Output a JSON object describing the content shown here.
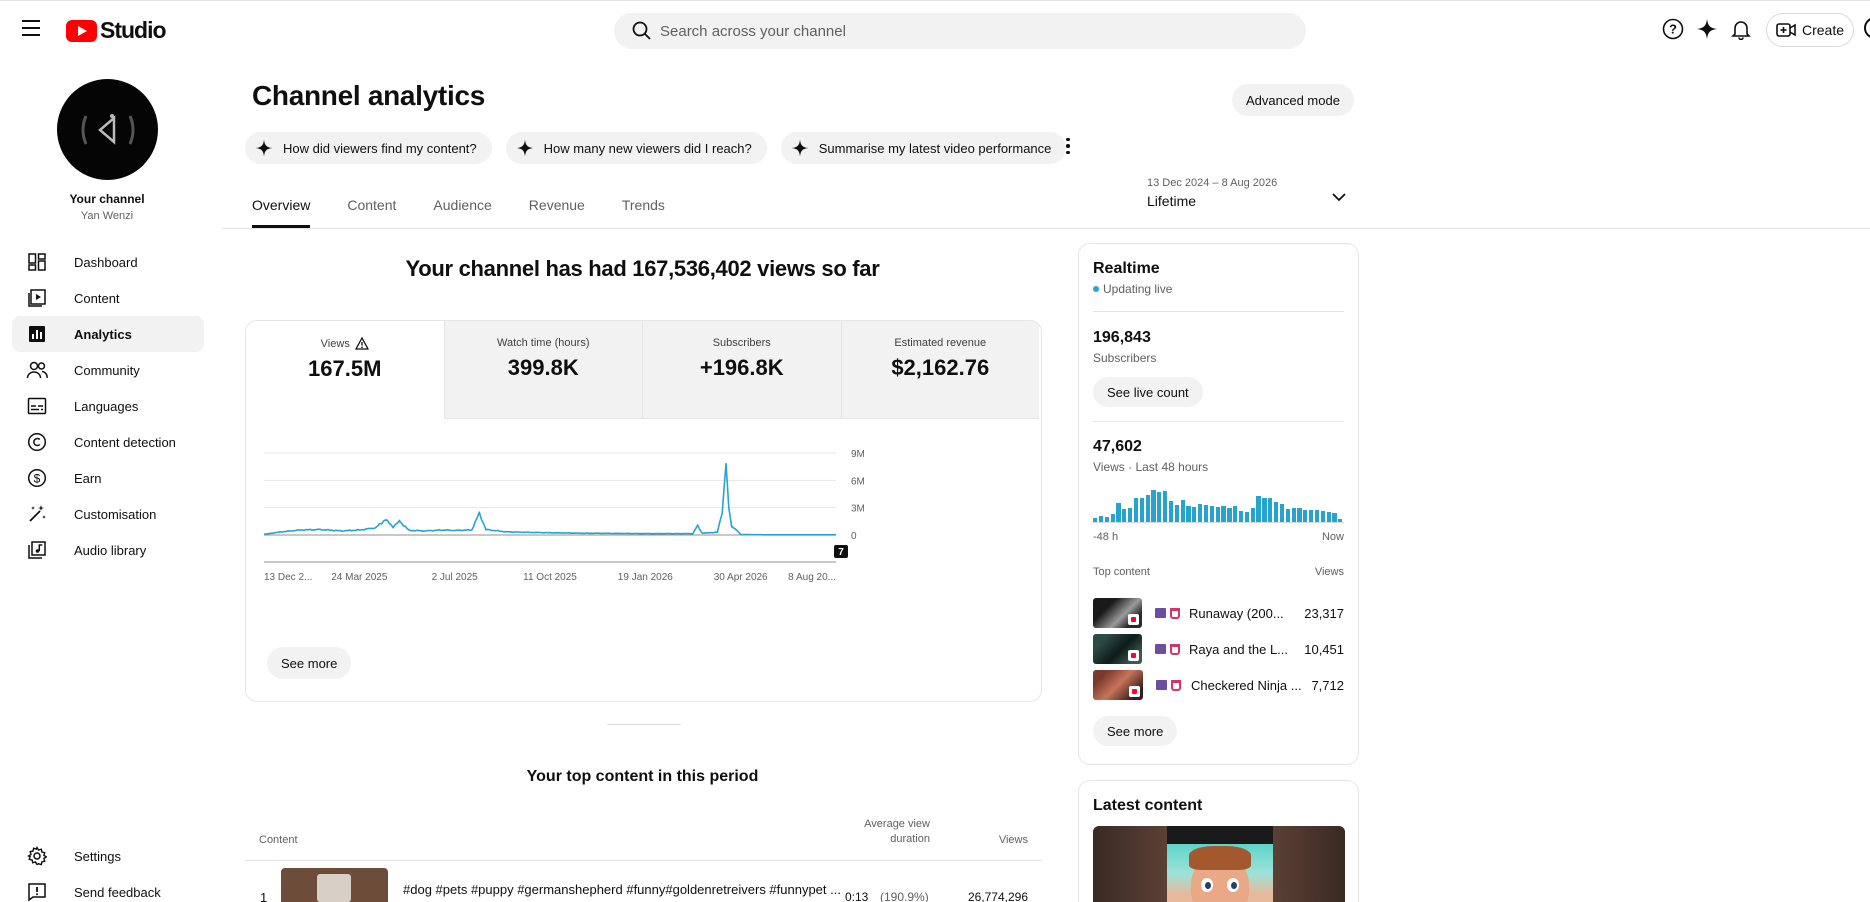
{
  "header": {
    "logo_text": "Studio",
    "search_placeholder": "Search across your channel",
    "create_label": "Create"
  },
  "sidebar": {
    "channel_title": "Your channel",
    "channel_name": "Yan Wenzi",
    "items": [
      {
        "label": "Dashboard",
        "icon": "dashboard-icon"
      },
      {
        "label": "Content",
        "icon": "content-icon"
      },
      {
        "label": "Analytics",
        "icon": "analytics-icon",
        "active": true
      },
      {
        "label": "Community",
        "icon": "community-icon"
      },
      {
        "label": "Languages",
        "icon": "languages-icon"
      },
      {
        "label": "Content detection",
        "icon": "copyright-icon"
      },
      {
        "label": "Earn",
        "icon": "dollar-icon"
      },
      {
        "label": "Customisation",
        "icon": "magic-wand-icon"
      },
      {
        "label": "Audio library",
        "icon": "audio-library-icon"
      }
    ],
    "bottom": [
      {
        "label": "Settings",
        "icon": "gear-icon"
      },
      {
        "label": "Send feedback",
        "icon": "feedback-icon"
      }
    ]
  },
  "main": {
    "title": "Channel analytics",
    "advanced_label": "Advanced mode",
    "chips": [
      "How did viewers find my content?",
      "How many new viewers did I reach?",
      "Summarise my latest video performance"
    ],
    "tabs": [
      "Overview",
      "Content",
      "Audience",
      "Revenue",
      "Trends"
    ],
    "date_range": "13 Dec 2024 – 8 Aug 2026",
    "date_label": "Lifetime",
    "headline": "Your channel has had 167,536,402 views so far",
    "metrics": [
      {
        "label": "Views",
        "value": "167.5M"
      },
      {
        "label": "Watch time (hours)",
        "value": "399.8K"
      },
      {
        "label": "Subscribers",
        "value": "+196.8K"
      },
      {
        "label": "Estimated revenue",
        "value": "$2,162.76"
      }
    ],
    "see_more": "See more",
    "top_content_title": "Your top content in this period",
    "table": {
      "col_content": "Content",
      "col_avd_1": "Average view",
      "col_avd_2": "duration",
      "col_views": "Views",
      "row1": {
        "rank": "1",
        "title": "#dog #pets #puppy #germanshepherd #funny#goldenretreivers #funnypet ...",
        "avd": "0:13",
        "avd_pct": "(190.9%)",
        "views": "26,774,296"
      }
    }
  },
  "chart_data": {
    "type": "line",
    "series": [
      {
        "values": [
          [
            "2024-12-13",
            0.08
          ],
          [
            "2025-01-01",
            0.35
          ],
          [
            "2025-01-20",
            0.55
          ],
          [
            "2025-02-10",
            0.6
          ],
          [
            "2025-03-05",
            0.45
          ],
          [
            "2025-03-24",
            0.55
          ],
          [
            "2025-04-10",
            0.8
          ],
          [
            "2025-04-20",
            1.7
          ],
          [
            "2025-04-28",
            0.9
          ],
          [
            "2025-05-05",
            1.5
          ],
          [
            "2025-05-15",
            0.5
          ],
          [
            "2025-06-01",
            0.45
          ],
          [
            "2025-06-20",
            0.55
          ],
          [
            "2025-07-02",
            0.5
          ],
          [
            "2025-07-20",
            0.55
          ],
          [
            "2025-07-28",
            2.4
          ],
          [
            "2025-08-04",
            0.6
          ],
          [
            "2025-08-25",
            0.35
          ],
          [
            "2025-09-15",
            0.3
          ],
          [
            "2025-10-11",
            0.25
          ],
          [
            "2025-11-10",
            0.2
          ],
          [
            "2025-12-15",
            0.18
          ],
          [
            "2026-01-19",
            0.15
          ],
          [
            "2026-02-20",
            0.15
          ],
          [
            "2026-03-10",
            0.15
          ],
          [
            "2026-03-15",
            1.0
          ],
          [
            "2026-03-20",
            0.2
          ],
          [
            "2026-04-05",
            0.3
          ],
          [
            "2026-04-10",
            2.5
          ],
          [
            "2026-04-14",
            7.8
          ],
          [
            "2026-04-17",
            3.0
          ],
          [
            "2026-04-20",
            1.0
          ],
          [
            "2026-04-30",
            0.05
          ],
          [
            "2026-06-01",
            0.02
          ],
          [
            "2026-07-01",
            0.02
          ],
          [
            "2026-08-08",
            0.02
          ]
        ]
      }
    ],
    "x_tick_labels": [
      "13 Dec 2...",
      "24 Mar 2025",
      "2 Jul 2025",
      "11 Oct 2025",
      "19 Jan 2026",
      "30 Apr 2026",
      "8 Aug 20..."
    ],
    "y_tick_labels": [
      "9M",
      "6M",
      "3M",
      "0"
    ],
    "ylim": [
      0,
      9
    ],
    "grid": true,
    "marker_badge": "7",
    "color": "#27a3cd"
  },
  "realtime": {
    "title": "Realtime",
    "status": "Updating live",
    "subscribers_value": "196,843",
    "subscribers_label": "Subscribers",
    "live_count_label": "See live count",
    "views_value": "47,602",
    "views_label": "Views · Last 48 hours",
    "bars": [
      0.12,
      0.18,
      0.15,
      0.25,
      0.55,
      0.38,
      0.42,
      0.7,
      0.72,
      0.8,
      0.95,
      0.88,
      0.92,
      0.62,
      0.5,
      0.66,
      0.48,
      0.45,
      0.52,
      0.5,
      0.48,
      0.44,
      0.47,
      0.4,
      0.46,
      0.32,
      0.3,
      0.4,
      0.78,
      0.7,
      0.72,
      0.58,
      0.52,
      0.38,
      0.42,
      0.4,
      0.36,
      0.34,
      0.35,
      0.32,
      0.3,
      0.26,
      0.1
    ],
    "axis_start": "-48 h",
    "axis_end": "Now",
    "top_content_label": "Top content",
    "top_views_label": "Views",
    "items": [
      {
        "title": "Runaway (200...",
        "views": "23,317"
      },
      {
        "title": "Raya and the L...",
        "views": "10,451"
      },
      {
        "title": "Checkered Ninja ...",
        "views": "7,712"
      }
    ]
  },
  "latest": {
    "title": "Latest content"
  }
}
